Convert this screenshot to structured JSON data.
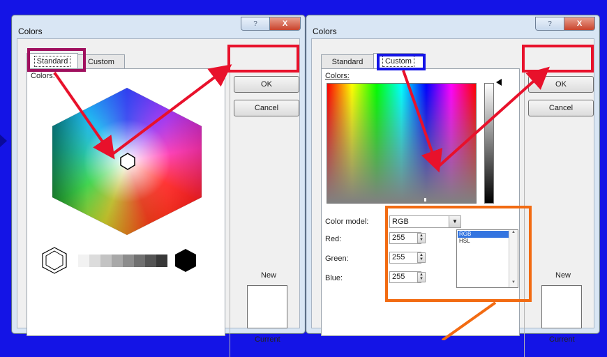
{
  "left_dialog": {
    "title": "Colors",
    "help": "?",
    "close": "X",
    "tabs": [
      {
        "label": "Standard"
      },
      {
        "label": "Custom"
      }
    ],
    "active_tab": "Standard",
    "colors_label": "Colors:",
    "ok": "OK",
    "cancel": "Cancel",
    "new_label": "New",
    "current_label": "Current",
    "selected_color": "#ffffff"
  },
  "right_dialog": {
    "title": "Colors",
    "help": "?",
    "close": "X",
    "tabs": [
      {
        "label": "Standard"
      },
      {
        "label": "Custom"
      }
    ],
    "active_tab": "Custom",
    "colors_label": "Colors:",
    "color_model_label": "Color model:",
    "color_model_value": "RGB",
    "color_model_options": [
      "RGB",
      "HSL"
    ],
    "red_label": "Red:",
    "green_label": "Green:",
    "blue_label": "Blue:",
    "red": "255",
    "green": "255",
    "blue": "255",
    "ok": "OK",
    "cancel": "Cancel",
    "new_label": "New",
    "current_label": "Current",
    "selected_color": "#ffffff"
  },
  "annotation_colors": {
    "red": "#e8112b",
    "magenta": "#a0105e",
    "blue": "#1414e6",
    "orange": "#f26b12",
    "background": "#1414e6"
  }
}
